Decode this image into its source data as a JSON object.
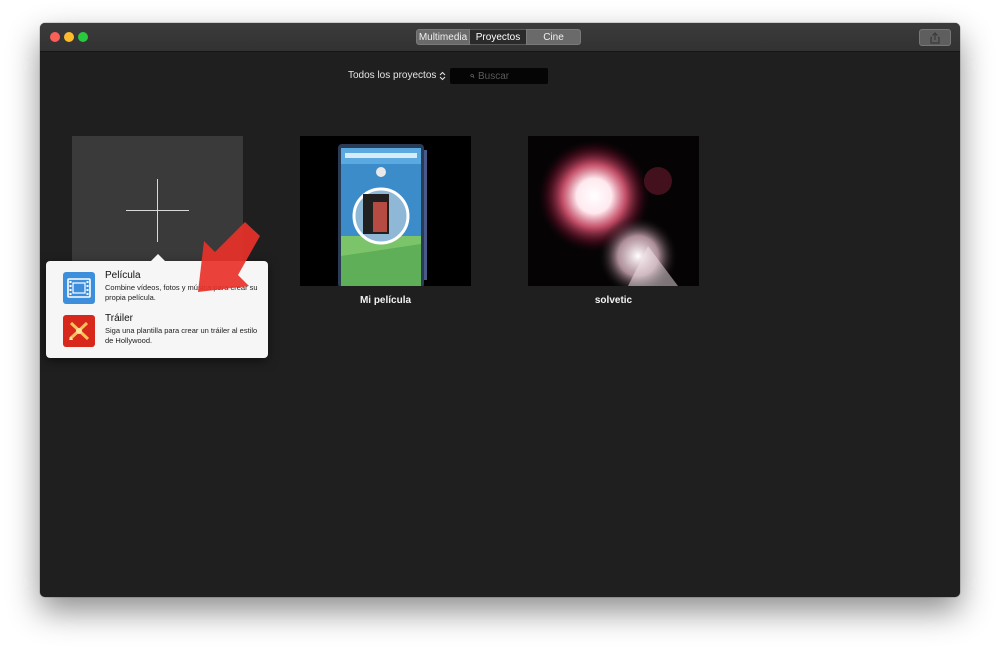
{
  "window": {
    "tabs": [
      {
        "label": "Multimedia",
        "selected": false
      },
      {
        "label": "Proyectos",
        "selected": true
      },
      {
        "label": "Cine",
        "selected": false
      }
    ],
    "share_icon": "share-icon"
  },
  "toolbar": {
    "filter_label": "Todos los proyectos",
    "filter_icon": "chevron-updown-icon",
    "search_placeholder": "Buscar",
    "search_value": ""
  },
  "new_project": {
    "icon": "plus-icon"
  },
  "projects": [
    {
      "title": "Mi película",
      "thumbnail": "phone-game-screen"
    },
    {
      "title": "solvetic",
      "thumbnail": "fireworks"
    }
  ],
  "popover": {
    "items": [
      {
        "title": "Película",
        "description": "Combine vídeos, fotos y música para crear su propia película.",
        "icon": "film-strip-icon"
      },
      {
        "title": "Tráiler",
        "description": "Siga una plantilla para crear un tráiler al estilo de Hollywood.",
        "icon": "trailer-clapper-icon"
      }
    ]
  },
  "colors": {
    "window_bg": "#1f1f1f",
    "titlebar_bg": "#353535",
    "annotation_arrow": "#e8312a",
    "pelicula_icon_bg": "#3d8fdc",
    "trailer_icon_bg": "#d8281c"
  }
}
